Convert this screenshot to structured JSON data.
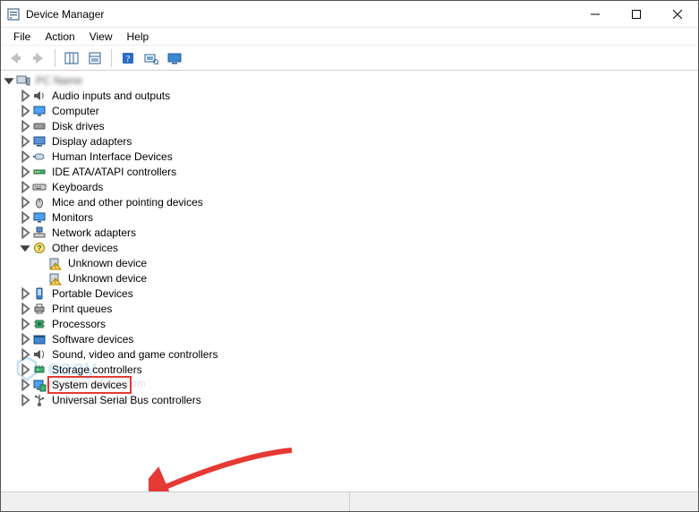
{
  "window": {
    "title": "Device Manager"
  },
  "menubar": {
    "items": [
      "File",
      "Action",
      "View",
      "Help"
    ]
  },
  "toolbar": {
    "buttons": [
      {
        "name": "back",
        "disabled": true
      },
      {
        "name": "forward",
        "disabled": true
      },
      {
        "name": "show-hidden",
        "disabled": false
      },
      {
        "name": "properties",
        "disabled": false
      },
      {
        "name": "help",
        "disabled": false
      },
      {
        "name": "scan",
        "disabled": false
      },
      {
        "name": "monitor-config",
        "disabled": false
      }
    ]
  },
  "tree": {
    "root": {
      "label": "PC Name",
      "expanded": true
    },
    "items": [
      {
        "label": "Audio inputs and outputs",
        "icon": "speaker-icon",
        "expandable": true
      },
      {
        "label": "Computer",
        "icon": "monitor-icon",
        "expandable": true
      },
      {
        "label": "Disk drives",
        "icon": "drive-icon",
        "expandable": true
      },
      {
        "label": "Display adapters",
        "icon": "display-icon",
        "expandable": true
      },
      {
        "label": "Human Interface Devices",
        "icon": "hid-icon",
        "expandable": true
      },
      {
        "label": "IDE ATA/ATAPI controllers",
        "icon": "ide-icon",
        "expandable": true
      },
      {
        "label": "Keyboards",
        "icon": "keyboard-icon",
        "expandable": true
      },
      {
        "label": "Mice and other pointing devices",
        "icon": "mouse-icon",
        "expandable": true
      },
      {
        "label": "Monitors",
        "icon": "monitor-icon",
        "expandable": true
      },
      {
        "label": "Network adapters",
        "icon": "network-icon",
        "expandable": true
      },
      {
        "label": "Other devices",
        "icon": "other-icon",
        "expandable": true,
        "expanded": true,
        "children": [
          {
            "label": "Unknown device",
            "icon": "warning-icon"
          },
          {
            "label": "Unknown device",
            "icon": "warning-icon"
          }
        ]
      },
      {
        "label": "Portable Devices",
        "icon": "portable-icon",
        "expandable": true
      },
      {
        "label": "Print queues",
        "icon": "printer-icon",
        "expandable": true
      },
      {
        "label": "Processors",
        "icon": "cpu-icon",
        "expandable": true
      },
      {
        "label": "Software devices",
        "icon": "software-icon",
        "expandable": true
      },
      {
        "label": "Sound, video and game controllers",
        "icon": "sound-icon",
        "expandable": true
      },
      {
        "label": "Storage controllers",
        "icon": "storage-icon",
        "expandable": true
      },
      {
        "label": "System devices",
        "icon": "system-icon",
        "expandable": true,
        "highlighted": true
      },
      {
        "label": "Universal Serial Bus controllers",
        "icon": "usb-icon",
        "expandable": true
      }
    ]
  },
  "watermark": {
    "text": "easy",
    "sub": "www.DriverEasy.com"
  }
}
